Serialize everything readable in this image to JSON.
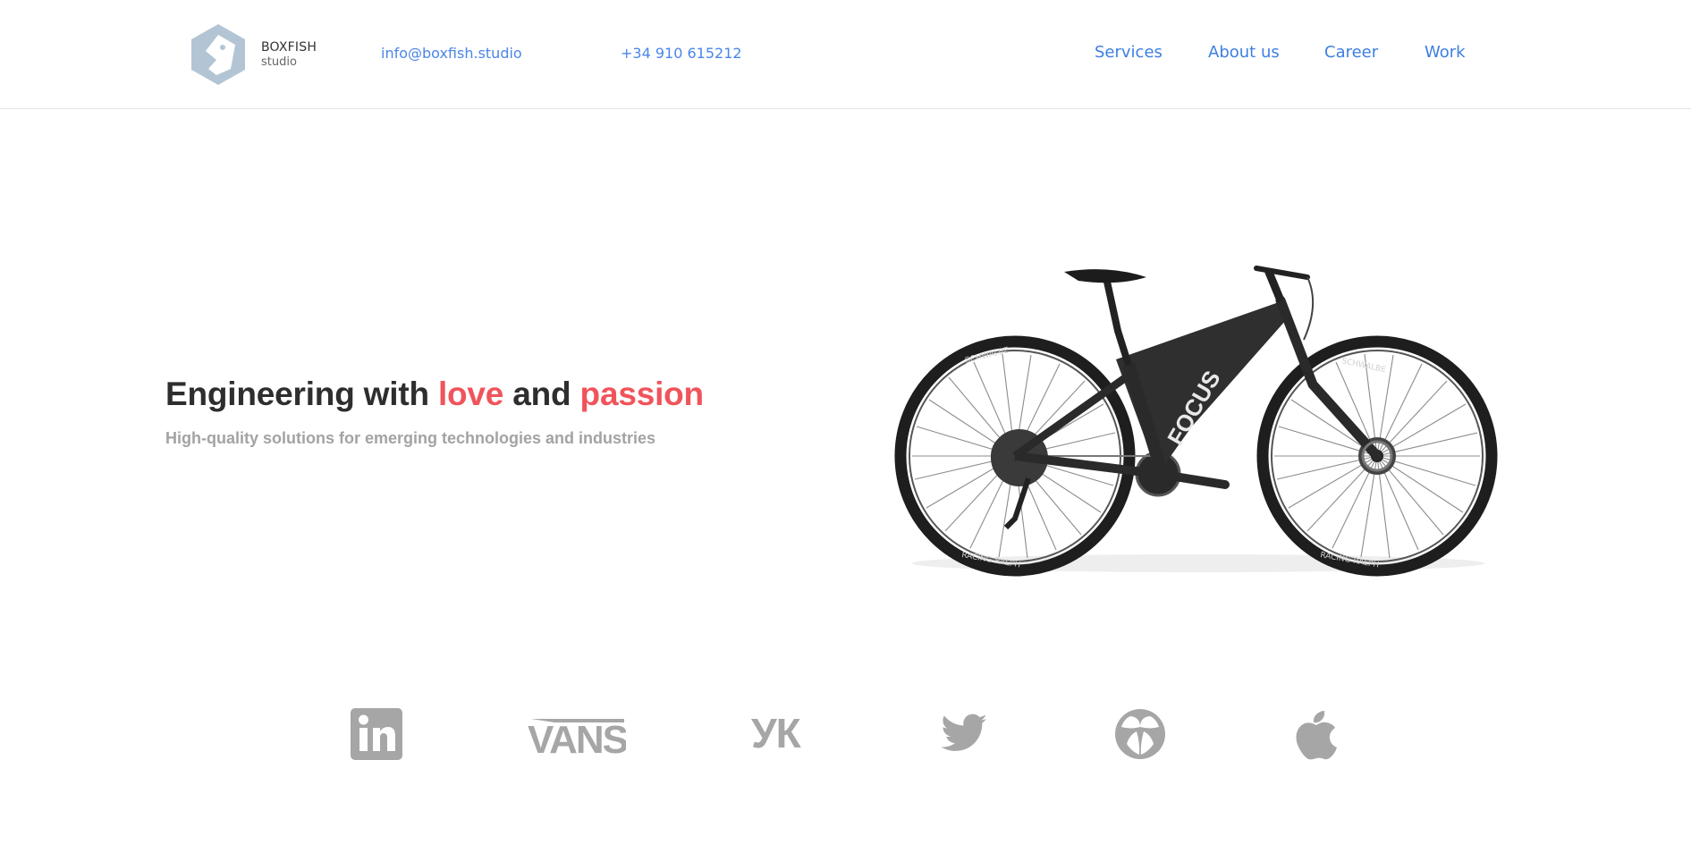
{
  "header": {
    "brand": {
      "name": "BOXFISH",
      "sub": "studio"
    },
    "contacts": {
      "email": "info@boxfish.studio",
      "phone": "+34 910 615212"
    },
    "nav": [
      {
        "label": "Services"
      },
      {
        "label": "About us"
      },
      {
        "label": "Career"
      },
      {
        "label": "Work"
      }
    ]
  },
  "hero": {
    "title": {
      "part1": "Engineering with ",
      "love": "love",
      "part2": " and ",
      "passion": "passion"
    },
    "subtitle": "High-quality solutions for emerging technologies and industries",
    "image": {
      "icon": "bicycle-image",
      "frame_text": "FOCUS",
      "tire_text_top": "SCHWALBE",
      "tire_text_bottom": "RACING RALPH"
    }
  },
  "brands": [
    {
      "icon": "linkedin-icon"
    },
    {
      "icon": "vans-logo",
      "text": "VANS"
    },
    {
      "icon": "vk-icon",
      "text": "УК"
    },
    {
      "icon": "twitter-icon"
    },
    {
      "icon": "circle-brand-icon"
    },
    {
      "icon": "apple-icon"
    }
  ],
  "colors": {
    "link": "#3d7fe0",
    "accent": "#f0545b",
    "heading": "#2e2e2e",
    "muted": "#a3a3a3",
    "logo": "#b3c5d4",
    "brand_icons": "#a6a6a6"
  }
}
